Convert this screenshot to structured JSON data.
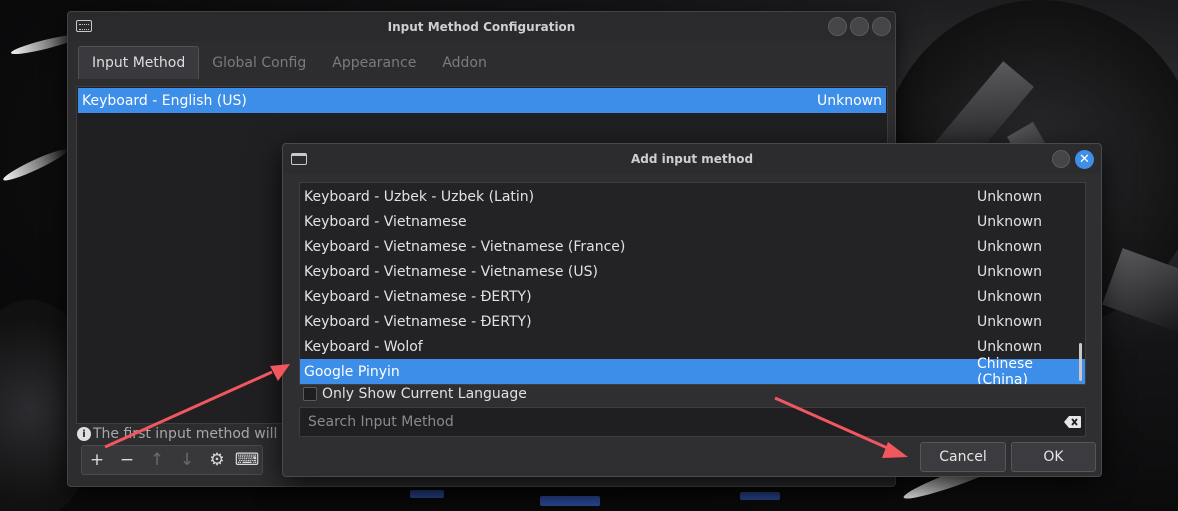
{
  "main_window": {
    "title": "Input Method Configuration",
    "tabs": [
      {
        "label": "Input Method",
        "active": true
      },
      {
        "label": "Global Config",
        "active": false
      },
      {
        "label": "Appearance",
        "active": false
      },
      {
        "label": "Addon",
        "active": false
      }
    ],
    "current_input_methods": [
      {
        "name": "Keyboard - English (US)",
        "language": "Unknown",
        "selected": true
      }
    ],
    "hint_text": "The first input method will be",
    "toolbar": [
      {
        "icon": "plus-icon",
        "glyph": "+",
        "enabled": true
      },
      {
        "icon": "minus-icon",
        "glyph": "−",
        "enabled": true
      },
      {
        "icon": "arrow-up-icon",
        "glyph": "↑",
        "enabled": false
      },
      {
        "icon": "arrow-down-icon",
        "glyph": "↓",
        "enabled": false
      },
      {
        "icon": "gear-icon",
        "glyph": "⚙",
        "enabled": true
      },
      {
        "icon": "keyboard-icon",
        "glyph": "⌨",
        "enabled": true
      }
    ]
  },
  "dialog": {
    "title": "Add input method",
    "items": [
      {
        "name": "Keyboard - Uzbek - Uzbek (Latin)",
        "language": "Unknown",
        "selected": false
      },
      {
        "name": "Keyboard - Vietnamese",
        "language": "Unknown",
        "selected": false
      },
      {
        "name": "Keyboard - Vietnamese - Vietnamese (France)",
        "language": "Unknown",
        "selected": false
      },
      {
        "name": "Keyboard - Vietnamese - Vietnamese (US)",
        "language": "Unknown",
        "selected": false
      },
      {
        "name": "Keyboard - Vietnamese - ĐERTY)",
        "language": "Unknown",
        "selected": false
      },
      {
        "name": "Keyboard - Vietnamese - ĐERTY)",
        "language": "Unknown",
        "selected": false
      },
      {
        "name": "Keyboard - Wolof",
        "language": "Unknown",
        "selected": false
      },
      {
        "name": "Google Pinyin",
        "language": "Chinese (China)",
        "selected": true
      }
    ],
    "only_show_current_language": {
      "label": "Only Show Current Language",
      "checked": false
    },
    "search": {
      "placeholder": "Search Input Method",
      "value": ""
    },
    "cancel_label": "Cancel",
    "ok_label": "OK"
  },
  "colors": {
    "selection": "#3d8ee8",
    "annotation_arrow": "#f2565e"
  }
}
